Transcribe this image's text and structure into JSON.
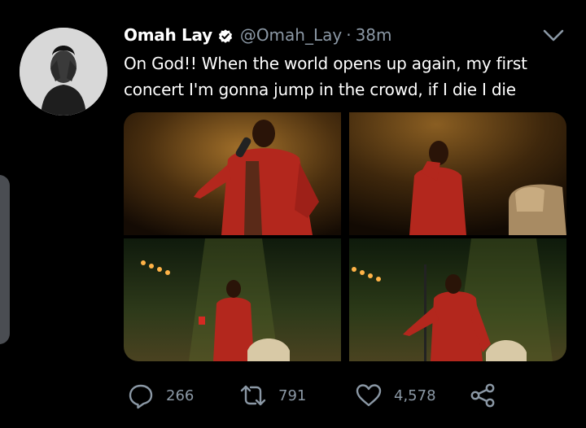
{
  "user": {
    "display_name": "Omah Lay",
    "handle": "@Omah_Lay",
    "separator": "·",
    "time": "38m",
    "verified": true
  },
  "tweet": {
    "line1": "On God!! When the world opens up again, my first",
    "line2": "concert I'm gonna jump in the crowd, if I die I die"
  },
  "media": {
    "photos": [
      {
        "icon": "performer-at-mic-photo"
      },
      {
        "icon": "performer-singing-photo"
      },
      {
        "icon": "performer-with-cup-stage-photo"
      },
      {
        "icon": "performer-reaching-stage-photo"
      }
    ]
  },
  "actions": {
    "reply_count": "266",
    "retweet_count": "791",
    "like_count": "4,578"
  },
  "colors": {
    "background": "#000000",
    "text": "#ffffff",
    "muted": "#8b98a5",
    "verified_badge": "#ffffff",
    "accent_red": "#c0281c"
  }
}
